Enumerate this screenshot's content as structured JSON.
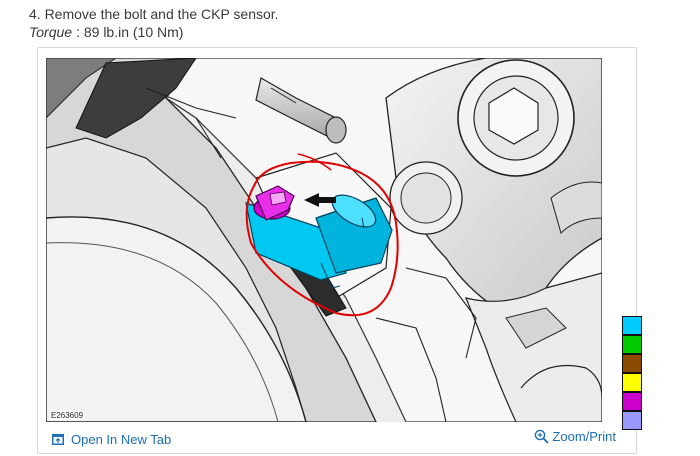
{
  "instruction": {
    "step_text": "4. Remove the bolt and the CKP sensor.",
    "torque_label": "Torque",
    "torque_value": ": 89 lb.in (10 Nm)"
  },
  "figure": {
    "figure_id": "E263609",
    "open_in_new_tab_label": "Open In New Tab",
    "zoom_print_label": "Zoom/Print"
  },
  "legend": {
    "colors": [
      "#00ccff",
      "#00cc00",
      "#8b4a00",
      "#ffff00",
      "#cc00cc",
      "#9999ff"
    ]
  }
}
